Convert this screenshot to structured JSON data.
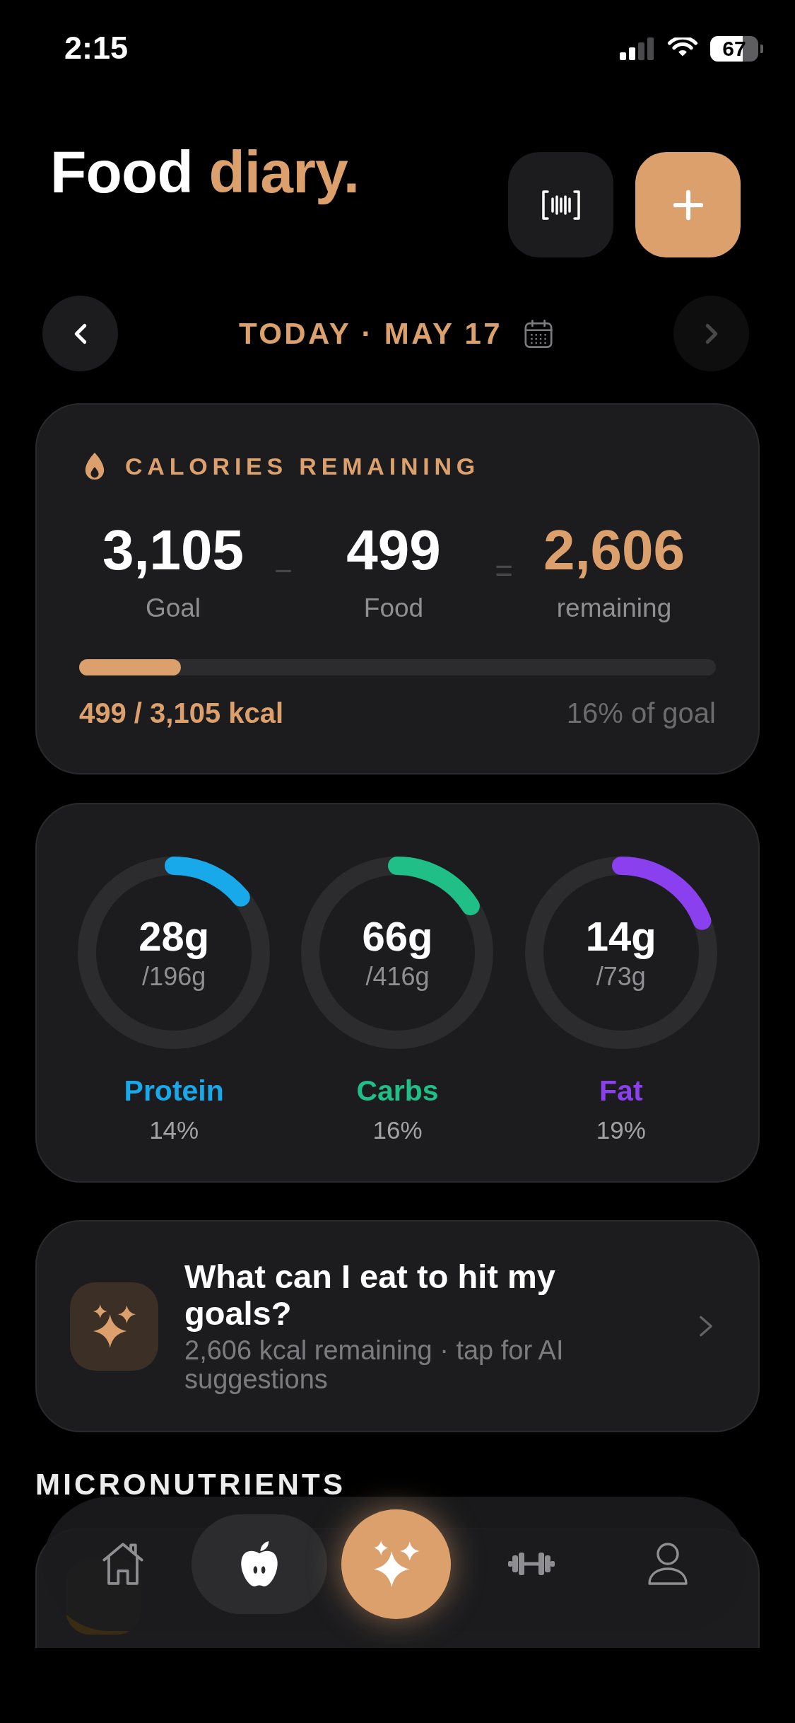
{
  "status_bar": {
    "time": "2:15",
    "battery": "67"
  },
  "header": {
    "title": [
      {
        "text": "Food",
        "accent": false
      },
      {
        "text": "diary.",
        "accent": true
      }
    ]
  },
  "date_nav": {
    "label": "TODAY · MAY 17",
    "prev": {
      "disabled": false
    },
    "next": {
      "disabled": true
    }
  },
  "calories": {
    "title": "CALORIES REMAINING",
    "equation": [
      {
        "kind": "number",
        "value": "3,105",
        "label": "Goal",
        "accent": false
      },
      {
        "kind": "operator",
        "symbol": "−"
      },
      {
        "kind": "number",
        "value": "499",
        "label": "Food",
        "accent": false
      },
      {
        "kind": "operator",
        "symbol": "="
      },
      {
        "kind": "number",
        "value": "2,606",
        "label": "remaining",
        "accent": true
      }
    ],
    "progress": {
      "level": 0.16,
      "consumed": "499 / 3,105 kcal",
      "percent": "16% of goal"
    }
  },
  "macros": [
    {
      "name": "Protein",
      "amount": "28g",
      "target": "/196g",
      "percent": "14%",
      "level": 0.14,
      "color": "#18a9eb"
    },
    {
      "name": "Carbs",
      "amount": "66g",
      "target": "/416g",
      "percent": "16%",
      "level": 0.16,
      "color": "#1fbf87"
    },
    {
      "name": "Fat",
      "amount": "14g",
      "target": "/73g",
      "percent": "19%",
      "level": 0.19,
      "color": "#8a40ef"
    }
  ],
  "ai_card": {
    "title": "What can I eat to hit my goals?",
    "subtitle": "2,606 kcal remaining · tap for AI suggestions"
  },
  "micronutrients": {
    "title": "MICRONUTRIENTS"
  },
  "tab_bar": {
    "items": [
      {
        "kind": "tab",
        "selected": false
      },
      {
        "kind": "tab",
        "selected": true
      },
      {
        "kind": "ai",
        "selected": false
      },
      {
        "kind": "tab",
        "selected": false
      },
      {
        "kind": "tab",
        "selected": false
      }
    ]
  }
}
